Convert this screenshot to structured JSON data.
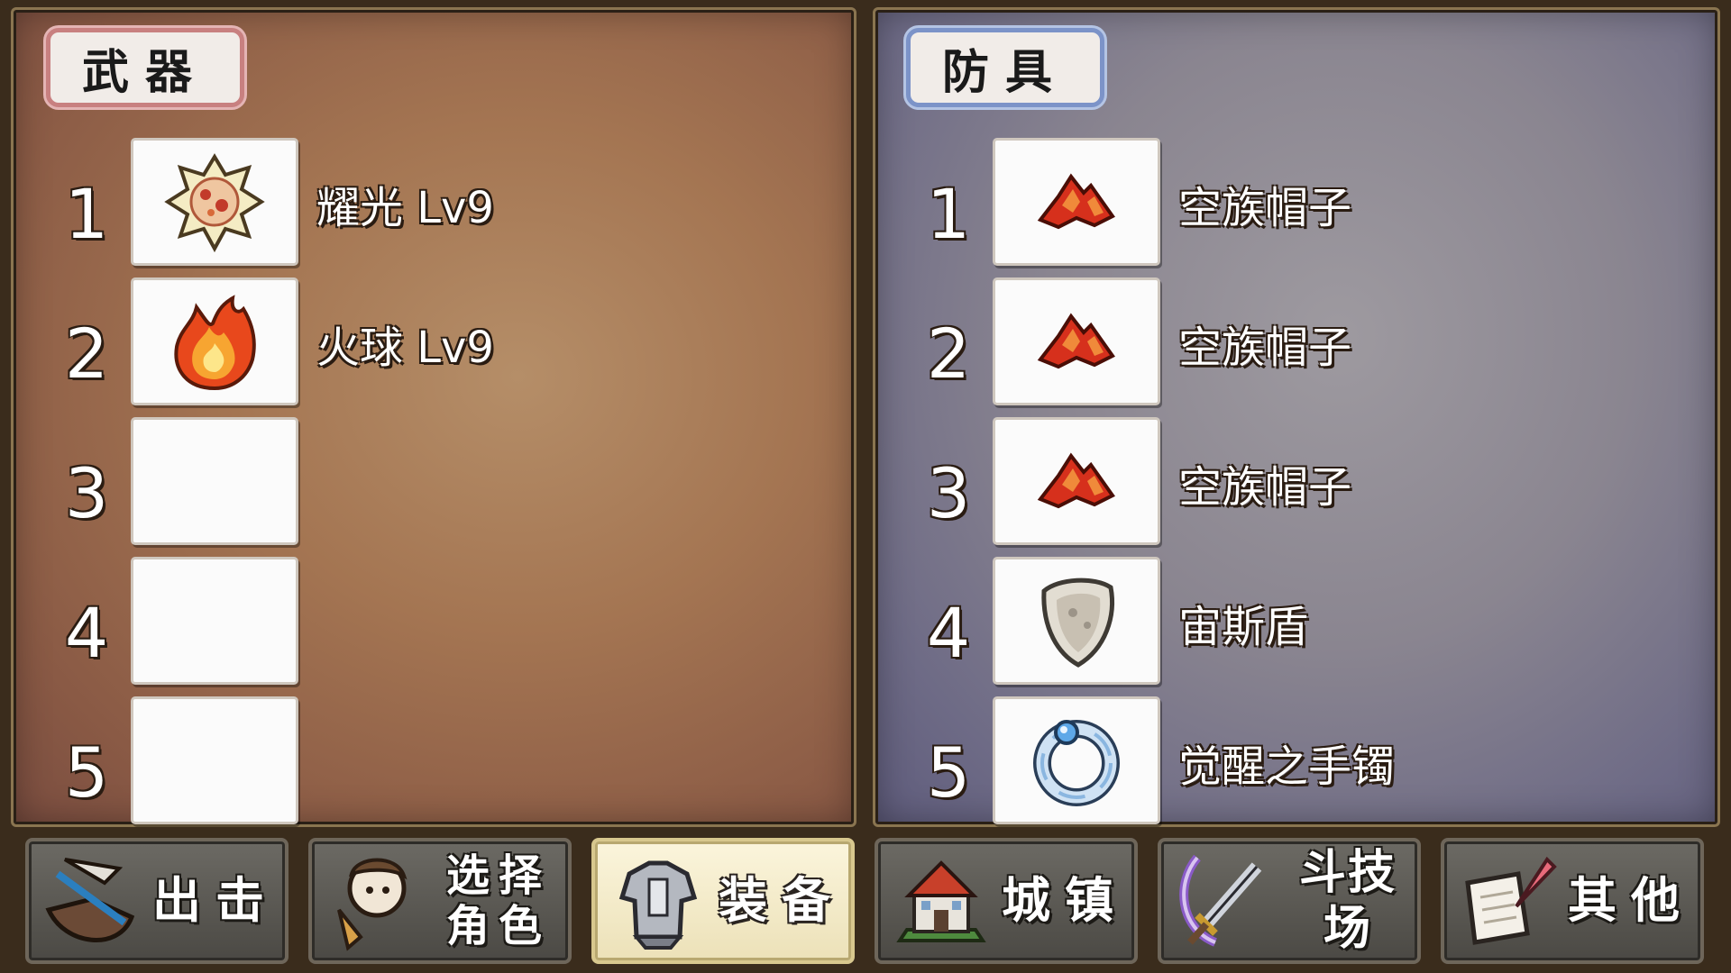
{
  "weapons": {
    "title": "武器",
    "slots": [
      {
        "number": "1",
        "name": "耀光 Lv9",
        "icon": "radiant-orb-icon"
      },
      {
        "number": "2",
        "name": "火球 Lv9",
        "icon": "fireball-icon"
      },
      {
        "number": "3",
        "name": "",
        "icon": ""
      },
      {
        "number": "4",
        "name": "",
        "icon": ""
      },
      {
        "number": "5",
        "name": "",
        "icon": ""
      }
    ]
  },
  "armor": {
    "title": "防具",
    "slots": [
      {
        "number": "1",
        "name": "空族帽子",
        "icon": "sky-hat-icon"
      },
      {
        "number": "2",
        "name": "空族帽子",
        "icon": "sky-hat-icon"
      },
      {
        "number": "3",
        "name": "空族帽子",
        "icon": "sky-hat-icon"
      },
      {
        "number": "4",
        "name": "宙斯盾",
        "icon": "aegis-shield-icon"
      },
      {
        "number": "5",
        "name": "觉醒之手镯",
        "icon": "awakening-bracelet-icon"
      }
    ]
  },
  "nav": {
    "sortie": "出击",
    "select_character_line1": "选择",
    "select_character_line2": "角色",
    "equipment": "装备",
    "town": "城镇",
    "arena": "斗技场",
    "other": "其他",
    "active": "equipment"
  },
  "colors": {
    "weapon_tag_border": "#c88080",
    "armor_tag_border": "#7c93c8",
    "active_nav_bg": "#fbf5dc"
  }
}
